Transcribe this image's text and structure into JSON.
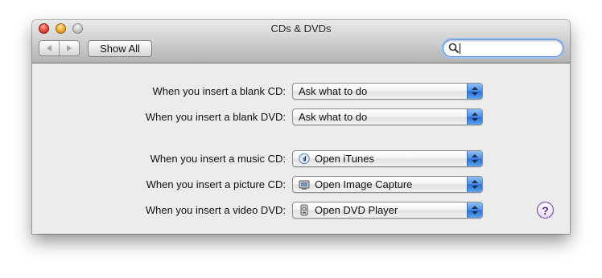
{
  "window": {
    "title": "CDs & DVDs"
  },
  "toolbar": {
    "show_all_label": "Show All",
    "search": {
      "value": "",
      "placeholder": ""
    }
  },
  "prefs": [
    {
      "label": "When you insert a blank CD:",
      "value": "Ask what to do",
      "icon": null
    },
    {
      "label": "When you insert a blank DVD:",
      "value": "Ask what to do",
      "icon": null
    },
    {
      "label": "When you insert a music CD:",
      "value": "Open iTunes",
      "icon": "itunes-icon"
    },
    {
      "label": "When you insert a picture CD:",
      "value": "Open Image Capture",
      "icon": "image-capture-icon"
    },
    {
      "label": "When you insert a video DVD:",
      "value": "Open DVD Player",
      "icon": "dvd-player-icon"
    }
  ],
  "help": {
    "label": "?"
  }
}
